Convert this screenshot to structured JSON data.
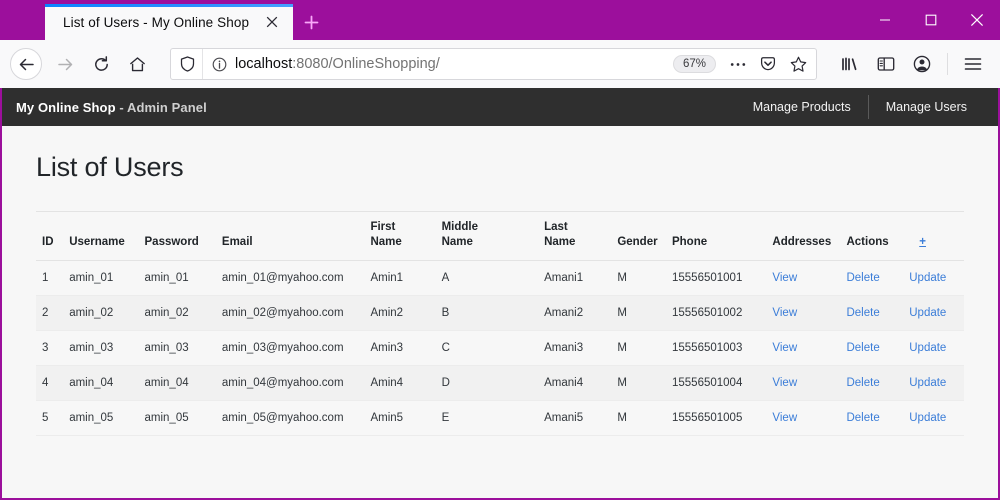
{
  "browser": {
    "tab": {
      "title": "List of Users - My Online Shop",
      "close_label": "✕"
    },
    "new_tab_label": "+",
    "window_controls": {
      "minimize": "─",
      "maximize": "□",
      "close": "✕"
    },
    "nav": {
      "back": "back-arrow",
      "forward": "forward-arrow",
      "reload": "reload",
      "home": "home"
    },
    "url": {
      "scheme_host": "localhost",
      "rest": ":8080/OnlineShopping/",
      "zoom": "67%"
    },
    "toolbar": {
      "menu_dots": "•••",
      "pocket": "pocket-icon",
      "bookmark": "☆",
      "library": "library-icon",
      "sidebar": "sidebar-icon",
      "account": "account-icon",
      "hamburger": "hamburger-icon"
    }
  },
  "app": {
    "brand": "My Online Shop",
    "brand_sub": " - Admin Panel",
    "nav_links": [
      "Manage Products",
      "Manage Users"
    ]
  },
  "main": {
    "page_title": "List of Users",
    "add_link": "+",
    "columns": [
      "ID",
      "Username",
      "Password",
      "Email",
      "First\nName",
      "Middle\nName",
      "Last\nName",
      "Gender",
      "Phone",
      "Addresses",
      "Actions"
    ],
    "rows": [
      {
        "id": "1",
        "username": "amin_01",
        "password": "amin_01",
        "email": "amin_01@myahoo.com",
        "first_name": "Amin1",
        "middle_name": "A",
        "last_name": "Amani1",
        "gender": "M",
        "phone": "15556501001",
        "addresses": "View",
        "delete": "Delete",
        "update": "Update"
      },
      {
        "id": "2",
        "username": "amin_02",
        "password": "amin_02",
        "email": "amin_02@myahoo.com",
        "first_name": "Amin2",
        "middle_name": "B",
        "last_name": "Amani2",
        "gender": "M",
        "phone": "15556501002",
        "addresses": "View",
        "delete": "Delete",
        "update": "Update"
      },
      {
        "id": "3",
        "username": "amin_03",
        "password": "amin_03",
        "email": "amin_03@myahoo.com",
        "first_name": "Amin3",
        "middle_name": "C",
        "last_name": "Amani3",
        "gender": "M",
        "phone": "15556501003",
        "addresses": "View",
        "delete": "Delete",
        "update": "Update"
      },
      {
        "id": "4",
        "username": "amin_04",
        "password": "amin_04",
        "email": "amin_04@myahoo.com",
        "first_name": "Amin4",
        "middle_name": "D",
        "last_name": "Amani4",
        "gender": "M",
        "phone": "15556501004",
        "addresses": "View",
        "delete": "Delete",
        "update": "Update"
      },
      {
        "id": "5",
        "username": "amin_05",
        "password": "amin_05",
        "email": "amin_05@myahoo.com",
        "first_name": "Amin5",
        "middle_name": "E",
        "last_name": "Amani5",
        "gender": "M",
        "phone": "15556501005",
        "addresses": "View",
        "delete": "Delete",
        "update": "Update"
      }
    ]
  },
  "colors": {
    "titlebar": "#9c0f9c",
    "appbar": "#2f2f2f",
    "link": "#3b7dd8",
    "tab_accent": "#0a84ff"
  }
}
